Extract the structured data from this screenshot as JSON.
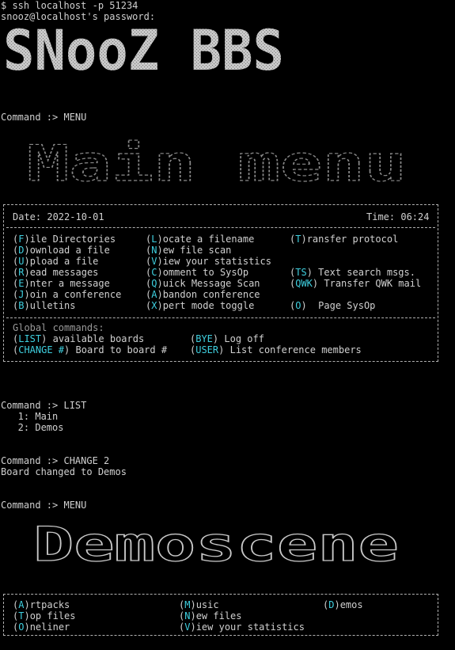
{
  "session": {
    "ssh_cmd": "$ ssh localhost -p 51234",
    "password_prompt": "snooz@localhost's password:",
    "banner_text": "SNooZ BBS"
  },
  "cmd1": "Command :> MENU",
  "main_menu": {
    "art_title": "Main menu",
    "date_label": "Date: 2022-10-01",
    "time_label": "Time: 06:24",
    "col1": [
      {
        "key": "F",
        "rest": "ile Directories"
      },
      {
        "key": "D",
        "rest": "ownload a file"
      },
      {
        "key": "U",
        "rest": "pload a file"
      },
      {
        "key": "R",
        "rest": "ead messages"
      },
      {
        "key": "E",
        "rest": "nter a message"
      },
      {
        "key": "J",
        "rest": "oin a conference"
      },
      {
        "key": "B",
        "rest": "ulletins"
      }
    ],
    "col2": [
      {
        "key": "L",
        "rest": "ocate a filename"
      },
      {
        "key": "N",
        "rest": "ew file scan"
      },
      {
        "key": "V",
        "rest": "iew your statistics"
      },
      {
        "key": "C",
        "rest": "omment to SysOp"
      },
      {
        "key": "Q",
        "rest": "uick Message Scan"
      },
      {
        "key": "A",
        "rest": "bandon conference"
      },
      {
        "key": "X",
        "rest": "pert mode toggle"
      }
    ],
    "col3": [
      {
        "key": "T",
        "rest": "ransfer protocol"
      },
      {
        "key": "TS",
        "rest": " Text search msgs."
      },
      {
        "key": "QWK",
        "rest": " Transfer QWK mail"
      },
      {
        "key": "O",
        "rest": "  Page SysOp"
      }
    ],
    "global_label": "Global commands:",
    "global": [
      {
        "key": "LIST",
        "rest": " available boards"
      },
      {
        "key": "BYE",
        "rest": " Log off"
      },
      {
        "key": "CHANGE #",
        "rest": " Board to board #"
      },
      {
        "key": "USER",
        "rest": " List conference members"
      }
    ]
  },
  "cmd2": "Command :> LIST",
  "boards": [
    "   1: Main",
    "   2: Demos"
  ],
  "cmd3": "Command :> CHANGE 2",
  "board_changed": "Board changed to Demos",
  "cmd4": "Command :> MENU",
  "demos_menu": {
    "art_title": "Demoscene",
    "items": [
      {
        "key": "A",
        "rest": "rtpacks"
      },
      {
        "key": "M",
        "rest": "usic"
      },
      {
        "key": "D",
        "rest": "emos"
      },
      {
        "key": "T",
        "rest": "op files"
      },
      {
        "key": "N",
        "rest": "ew files"
      },
      {
        "key": "O",
        "rest": "neliner"
      },
      {
        "key": "V",
        "rest": "iew your statistics"
      }
    ]
  },
  "colors": {
    "hotkey": "#3fd0e0",
    "text": "#d0d0d0",
    "dim": "#9a9a9a",
    "background": "#000000"
  }
}
